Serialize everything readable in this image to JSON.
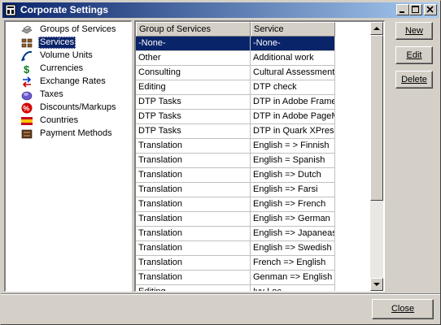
{
  "window": {
    "title": "Corporate Settings"
  },
  "tree": {
    "items": [
      {
        "label": "Groups of Services",
        "icon": "groups-icon"
      },
      {
        "label": "Services",
        "icon": "services-icon",
        "selected": true
      },
      {
        "label": "Volume Units",
        "icon": "volume-units-icon"
      },
      {
        "label": "Currencies",
        "icon": "currency-icon"
      },
      {
        "label": "Exchange Rates",
        "icon": "exchange-rates-icon"
      },
      {
        "label": "Taxes",
        "icon": "taxes-icon"
      },
      {
        "label": "Discounts/Markups",
        "icon": "discounts-icon"
      },
      {
        "label": "Countries",
        "icon": "flag-icon"
      },
      {
        "label": "Payment Methods",
        "icon": "payment-methods-icon"
      }
    ]
  },
  "grid": {
    "columns": [
      "Group of Services",
      "Service"
    ],
    "rows": [
      [
        "-None-",
        "-None-"
      ],
      [
        "Other",
        "Additional work"
      ],
      [
        "Consulting",
        "Cultural Assessment"
      ],
      [
        "Editing",
        "DTP check"
      ],
      [
        "DTP Tasks",
        "DTP in Adobe Frame"
      ],
      [
        "DTP Tasks",
        "DTP in Adobe PageM"
      ],
      [
        "DTP Tasks",
        "DTP in Quark XPress"
      ],
      [
        "Translation",
        "English = > Finnish"
      ],
      [
        "Translation",
        "English = Spanish"
      ],
      [
        "Translation",
        "English => Dutch"
      ],
      [
        "Translation",
        "English => Farsi"
      ],
      [
        "Translation",
        "English => French"
      ],
      [
        "Translation",
        "English => German"
      ],
      [
        "Translation",
        "English => Japanease"
      ],
      [
        "Translation",
        "English => Swedish"
      ],
      [
        "Translation",
        "French => English"
      ],
      [
        "Translation",
        "Genman => English"
      ],
      [
        "Editing",
        "Ivy Loc"
      ]
    ],
    "selected_row": 0
  },
  "buttons": {
    "new": {
      "label": "New"
    },
    "edit": {
      "label": "Edit"
    },
    "delete": {
      "label": "Delete"
    },
    "close": {
      "label": "Close"
    }
  },
  "colors": {
    "selection": "#0a246a",
    "titlebar_start": "#0a246a",
    "titlebar_end": "#a6caf0",
    "face": "#d4d0c8"
  }
}
